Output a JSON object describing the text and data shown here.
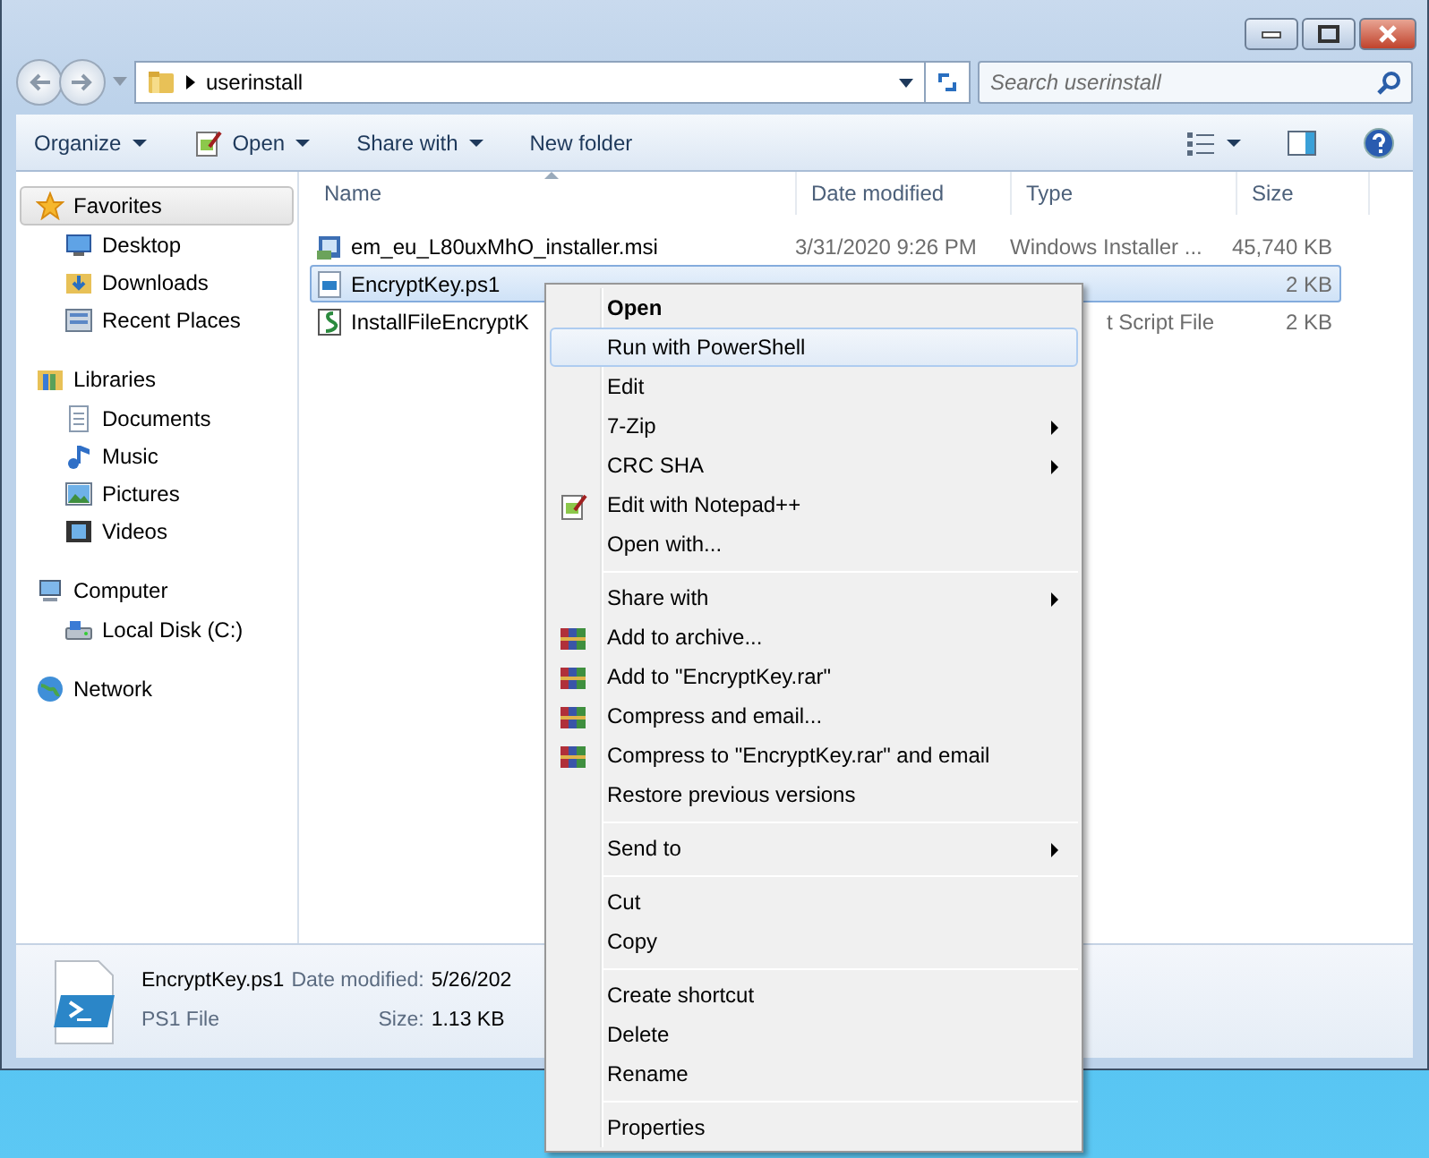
{
  "address_bar": {
    "path": "userinstall",
    "search_placeholder": "Search userinstall"
  },
  "toolbar": {
    "items": [
      {
        "label": "Organize",
        "dropdown": true,
        "kind": "plain"
      },
      {
        "label": "Open",
        "dropdown": true,
        "kind": "open"
      },
      {
        "label": "Share with",
        "dropdown": true,
        "kind": "plain"
      },
      {
        "label": "New folder",
        "dropdown": false,
        "kind": "plain"
      }
    ]
  },
  "sidebar": {
    "groups": [
      {
        "label": "Favorites",
        "kind": "favorites",
        "selected": true,
        "items": [
          {
            "label": "Desktop",
            "kind": "desktop"
          },
          {
            "label": "Downloads",
            "kind": "downloads"
          },
          {
            "label": "Recent Places",
            "kind": "recent"
          }
        ]
      },
      {
        "label": "Libraries",
        "kind": "libraries",
        "selected": false,
        "items": [
          {
            "label": "Documents",
            "kind": "documents"
          },
          {
            "label": "Music",
            "kind": "music"
          },
          {
            "label": "Pictures",
            "kind": "pictures"
          },
          {
            "label": "Videos",
            "kind": "videos"
          }
        ]
      },
      {
        "label": "Computer",
        "kind": "computer",
        "selected": false,
        "items": [
          {
            "label": "Local Disk (C:)",
            "kind": "disk"
          }
        ]
      },
      {
        "label": "Network",
        "kind": "network",
        "selected": false
      }
    ]
  },
  "table": {
    "columns": [
      "Name",
      "Date modified",
      "Type",
      "Size"
    ],
    "rows": [
      {
        "name": "em_eu_L80uxMhO_installer.msi",
        "kind": "msi",
        "date": "3/31/2020 9:26 PM",
        "type": "Windows Installer ...",
        "size": "45,740 KB",
        "selected": false
      },
      {
        "name": "EncryptKey.ps1",
        "kind": "ps1",
        "size": "2 KB",
        "selected": true
      },
      {
        "name": "InstallFileEncryptK",
        "kind": "script",
        "type": "t Script File",
        "size": "2 KB",
        "selected": false
      }
    ]
  },
  "details": {
    "name": "EncryptKey.ps1",
    "date_label": "Date modified:",
    "date": "5/26/202",
    "type": "PS1 File",
    "size_label": "Size:",
    "size": "1.13 KB"
  },
  "context_menu": [
    {
      "kind": "item",
      "label": "Open",
      "default": true,
      "selected": false,
      "submenu": false
    },
    {
      "kind": "item",
      "label": "Run with PowerShell",
      "default": false,
      "selected": true,
      "submenu": false
    },
    {
      "kind": "item",
      "label": "Edit",
      "default": false,
      "selected": false,
      "submenu": false
    },
    {
      "kind": "item",
      "label": "7-Zip",
      "default": false,
      "selected": false,
      "submenu": true
    },
    {
      "kind": "item",
      "label": "CRC SHA",
      "default": false,
      "selected": false,
      "submenu": true
    },
    {
      "kind": "item",
      "label": "Edit with Notepad++",
      "default": false,
      "selected": false,
      "submenu": false
    },
    {
      "kind": "item",
      "label": "Open with...",
      "default": false,
      "selected": false,
      "submenu": false
    },
    {
      "kind": "separator"
    },
    {
      "kind": "item",
      "label": "Share with",
      "default": false,
      "selected": false,
      "submenu": true
    },
    {
      "kind": "item",
      "label": "Add to archive...",
      "default": false,
      "selected": false,
      "submenu": false
    },
    {
      "kind": "item",
      "label": "Add to \"EncryptKey.rar\"",
      "default": false,
      "selected": false,
      "submenu": false
    },
    {
      "kind": "item",
      "label": "Compress and email...",
      "default": false,
      "selected": false,
      "submenu": false
    },
    {
      "kind": "item",
      "label": "Compress to \"EncryptKey.rar\" and email",
      "default": false,
      "selected": false,
      "submenu": false
    },
    {
      "kind": "item",
      "label": "Restore previous versions",
      "default": false,
      "selected": false,
      "submenu": false
    },
    {
      "kind": "separator"
    },
    {
      "kind": "item",
      "label": "Send to",
      "default": false,
      "selected": false,
      "submenu": true
    },
    {
      "kind": "separator"
    },
    {
      "kind": "item",
      "label": "Cut",
      "default": false,
      "selected": false,
      "submenu": false
    },
    {
      "kind": "item",
      "label": "Copy",
      "default": false,
      "selected": false,
      "submenu": false
    },
    {
      "kind": "separator"
    },
    {
      "kind": "item",
      "label": "Create shortcut",
      "default": false,
      "selected": false,
      "submenu": false
    },
    {
      "kind": "item",
      "label": "Delete",
      "default": false,
      "selected": false,
      "submenu": false
    },
    {
      "kind": "item",
      "label": "Rename",
      "default": false,
      "selected": false,
      "submenu": false
    },
    {
      "kind": "separator"
    },
    {
      "kind": "item",
      "label": "Properties",
      "default": false,
      "selected": false,
      "submenu": false
    }
  ]
}
